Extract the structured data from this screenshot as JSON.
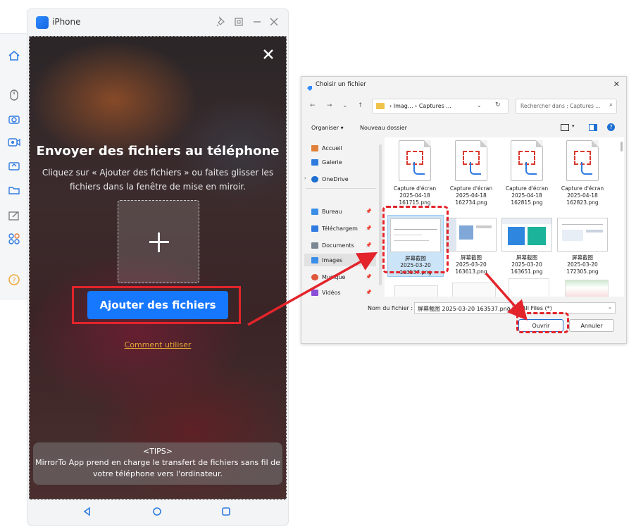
{
  "mirror_window": {
    "title": "iPhone",
    "phone": {
      "heading": "Envoyer des fichiers au téléphone",
      "subtitle": "Cliquez sur « Ajouter des fichiers » ou faites glisser les fichiers dans la fenêtre de mise en miroir.",
      "add_button": "Ajouter des fichiers",
      "howto_link": "Comment utiliser",
      "tips_title": "<TIPS>",
      "tips_text": "MirrorTo App prend en charge le transfert de fichiers sans fil de votre téléphone vers l'ordinateur."
    },
    "left_rail_icons": [
      "home-icon",
      "mouse-icon",
      "camera-icon",
      "record-icon",
      "cast-icon",
      "folder-icon",
      "edit-icon",
      "apps-icon",
      "help-icon"
    ]
  },
  "file_dialog": {
    "title": "Choisir un fichier",
    "address": {
      "segments": [
        "Imag...",
        "Captures ..."
      ]
    },
    "search_placeholder": "Rechercher dans : Captures ...",
    "toolbar": {
      "organize": "Organiser ▾",
      "new_folder": "Nouveau dossier"
    },
    "sidebar": [
      {
        "label": "Accueil",
        "icon": "home-icon",
        "color": "#e0803a"
      },
      {
        "label": "Galerie",
        "icon": "gallery-icon",
        "color": "#2f7be0"
      },
      {
        "label": "OneDrive",
        "icon": "cloud-icon",
        "color": "#1f6fd1"
      },
      {
        "label": "Bureau",
        "icon": "desktop-icon",
        "color": "#3b8ee8"
      },
      {
        "label": "Téléchargem",
        "icon": "download-icon",
        "color": "#2f7be0"
      },
      {
        "label": "Documents",
        "icon": "documents-icon",
        "color": "#7a8894"
      },
      {
        "label": "Images",
        "icon": "images-icon",
        "color": "#3b8ee8"
      },
      {
        "label": "Musique",
        "icon": "music-icon",
        "color": "#e0563a"
      },
      {
        "label": "Vidéos",
        "icon": "video-icon",
        "color": "#8a4fd6"
      }
    ],
    "files_row1": [
      {
        "l1": "Capture d'écran",
        "l2": "2025-04-18",
        "l3": "161715.png"
      },
      {
        "l1": "Capture d'écran",
        "l2": "2025-04-18",
        "l3": "162734.png"
      },
      {
        "l1": "Capture d'écran",
        "l2": "2025-04-18",
        "l3": "162815.png"
      },
      {
        "l1": "Capture d'écran",
        "l2": "2025-04-18",
        "l3": "162823.png"
      }
    ],
    "files_row2": [
      {
        "l1": "屏幕截图",
        "l2": "2025-03-20",
        "l3": "163537.png"
      },
      {
        "l1": "屏幕截图",
        "l2": "2025-03-20",
        "l3": "163613.png"
      },
      {
        "l1": "屏幕截图",
        "l2": "2025-03-20",
        "l3": "163651.png"
      },
      {
        "l1": "屏幕截图",
        "l2": "2025-03-20",
        "l3": "172305.png"
      }
    ],
    "filename_label": "Nom du fichier :",
    "filename_value": "屏幕截图 2025-03-20 163537.png",
    "filetype_value": "All Files (*)",
    "open_button": "Ouvrir",
    "cancel_button": "Annuler"
  },
  "colors": {
    "accent": "#1677ff",
    "highlight_red": "#e3242b",
    "link_orange": "#e3a536"
  }
}
